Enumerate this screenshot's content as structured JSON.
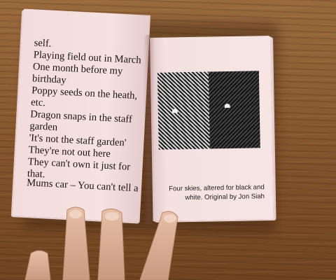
{
  "left_page": {
    "lines": [
      "self.",
      "Playing field out in March",
      "One month before my",
      "birthday",
      "Poppy seeds on the heath,",
      "etc.",
      "Dragon snaps in the staff",
      "garden",
      "'It's not the staff garden'",
      "They're not out here",
      "They can't own it just for",
      "that."
    ],
    "footer": "Mums car – You can't tell a"
  },
  "right_page": {
    "caption_line1": "Four skies, altered for black and",
    "caption_line2": "white. Original by Jon Siah"
  },
  "colors": {
    "page": "#f5e2e1",
    "table": "#8a5a32",
    "ink": "#1a1414"
  }
}
